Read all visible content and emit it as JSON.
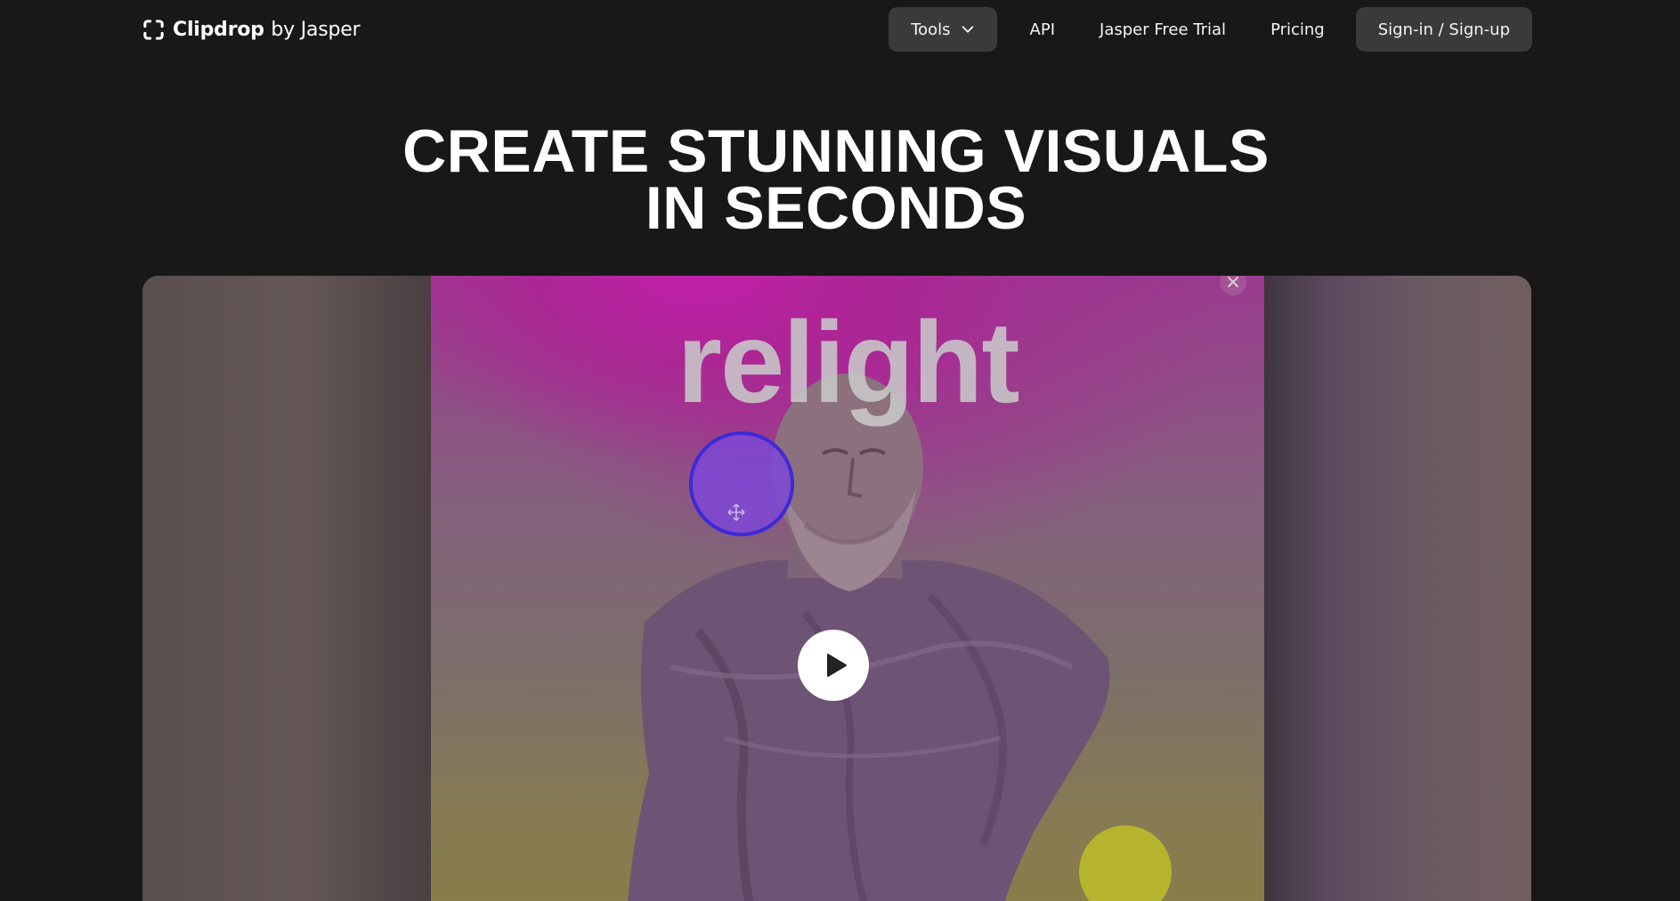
{
  "header": {
    "logo": {
      "brand": "Clipdrop",
      "suffix": "by Jasper",
      "icon": "clipdrop-logo-icon"
    },
    "nav": {
      "tools_label": "Tools",
      "tools_icon": "chevron-down-icon",
      "api_label": "API",
      "trial_label": "Jasper Free Trial",
      "pricing_label": "Pricing",
      "signin_label": "Sign-in / Sign-up"
    }
  },
  "hero": {
    "title_line1": "CREATE STUNNING VISUALS",
    "title_line2": "IN SECONDS"
  },
  "video": {
    "overlay_word": "relight",
    "play_icon": "play-icon",
    "close_icon": "close-icon",
    "handle_icon": "move-icon"
  },
  "colors": {
    "background": "#181818",
    "nav_button_bg": "#3a3a3a",
    "text": "#ffffff",
    "light_handle": "#3e2ad6"
  }
}
